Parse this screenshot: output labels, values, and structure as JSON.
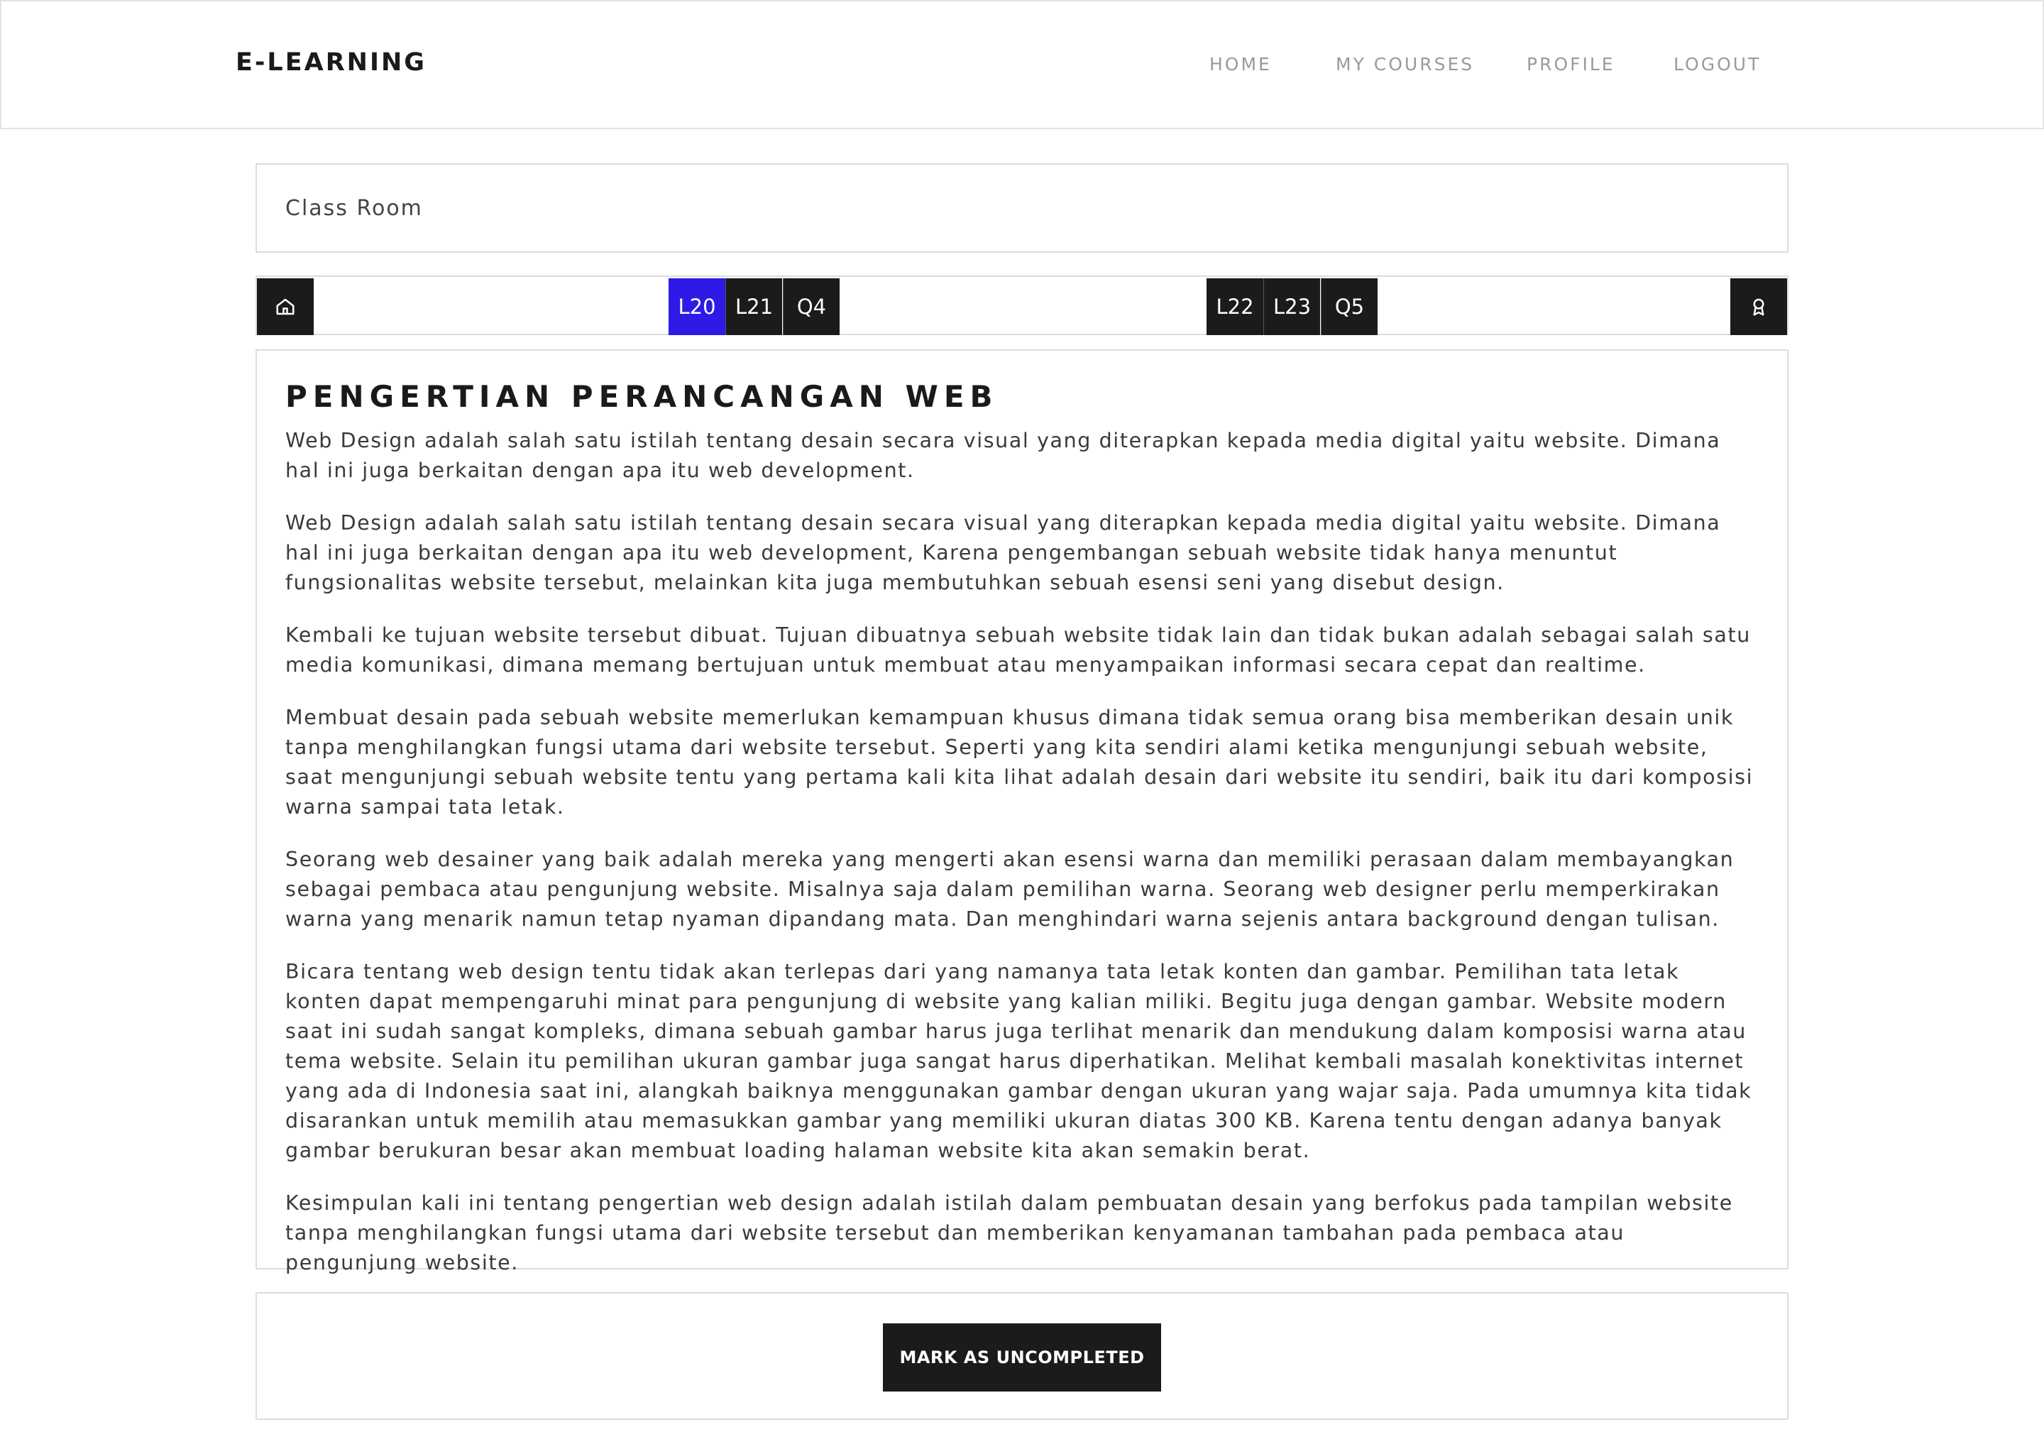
{
  "header": {
    "brand": "E-LEARNING",
    "nav": [
      "HOME",
      "MY COURSES",
      "PROFILE",
      "LOGOUT"
    ]
  },
  "classroom": {
    "label": "Class Room"
  },
  "lessons": {
    "home_icon": "home-icon",
    "certificate_icon": "award-icon",
    "group1": [
      "L20",
      "L21",
      "Q4"
    ],
    "group2": [
      "L22",
      "L23",
      "Q5"
    ],
    "active": "L20",
    "active_color": "#2e1ae6"
  },
  "content": {
    "title": "PENGERTIAN PERANCANGAN WEB",
    "paragraphs": [
      "Web Design adalah salah satu istilah tentang desain secara visual yang diterapkan kepada media digital yaitu website. Dimana hal ini juga berkaitan dengan apa itu web development.",
      "Web Design adalah salah satu istilah tentang desain secara visual yang diterapkan kepada media digital yaitu website. Dimana hal ini juga berkaitan dengan apa itu web development, Karena pengembangan sebuah website tidak hanya menuntut fungsionalitas website tersebut, melainkan kita juga membutuhkan sebuah esensi seni yang disebut design.",
      "Kembali ke tujuan website tersebut dibuat. Tujuan dibuatnya sebuah website tidak lain dan tidak bukan adalah sebagai salah satu media komunikasi, dimana memang bertujuan untuk membuat atau menyampaikan informasi secara cepat dan realtime.",
      "Membuat desain pada sebuah website memerlukan kemampuan khusus dimana tidak semua orang bisa  memberikan desain unik tanpa menghilangkan fungsi utama dari website tersebut. Seperti yang kita sendiri alami ketika mengunjungi sebuah website, saat mengunjungi sebuah website tentu yang pertama kali kita lihat adalah desain dari website itu sendiri, baik itu dari komposisi warna sampai tata letak.",
      "Seorang web desainer yang baik adalah mereka yang mengerti akan esensi warna dan memiliki perasaan dalam membayangkan sebagai pembaca atau pengunjung website. Misalnya saja dalam pemilihan warna. Seorang web designer perlu memperkirakan warna yang menarik namun tetap nyaman dipandang mata. Dan menghindari warna sejenis antara background dengan tulisan.",
      "Bicara tentang web design tentu tidak akan terlepas dari yang namanya tata letak konten dan gambar. Pemilihan tata letak konten dapat mempengaruhi minat para pengunjung di website yang kalian miliki. Begitu juga dengan gambar. Website modern saat ini sudah sangat kompleks, dimana sebuah gambar harus juga terlihat menarik dan mendukung dalam komposisi warna atau tema website. Selain itu pemilihan ukuran gambar juga sangat harus diperhatikan. Melihat kembali masalah konektivitas internet yang ada di Indonesia saat ini, alangkah baiknya menggunakan gambar dengan ukuran yang wajar saja. Pada umumnya kita tidak disarankan untuk memilih atau memasukkan gambar yang memiliki ukuran diatas 300 KB. Karena tentu dengan adanya banyak gambar berukuran besar akan membuat loading halaman website kita akan semakin berat.",
      "Kesimpulan kali ini tentang pengertian web design adalah istilah dalam pembuatan desain yang berfokus pada tampilan website tanpa menghilangkan fungsi utama dari website tersebut dan memberikan kenyamanan tambahan pada pembaca atau pengunjung website."
    ]
  },
  "action": {
    "button_label": "MARK AS UNCOMPLETED"
  }
}
